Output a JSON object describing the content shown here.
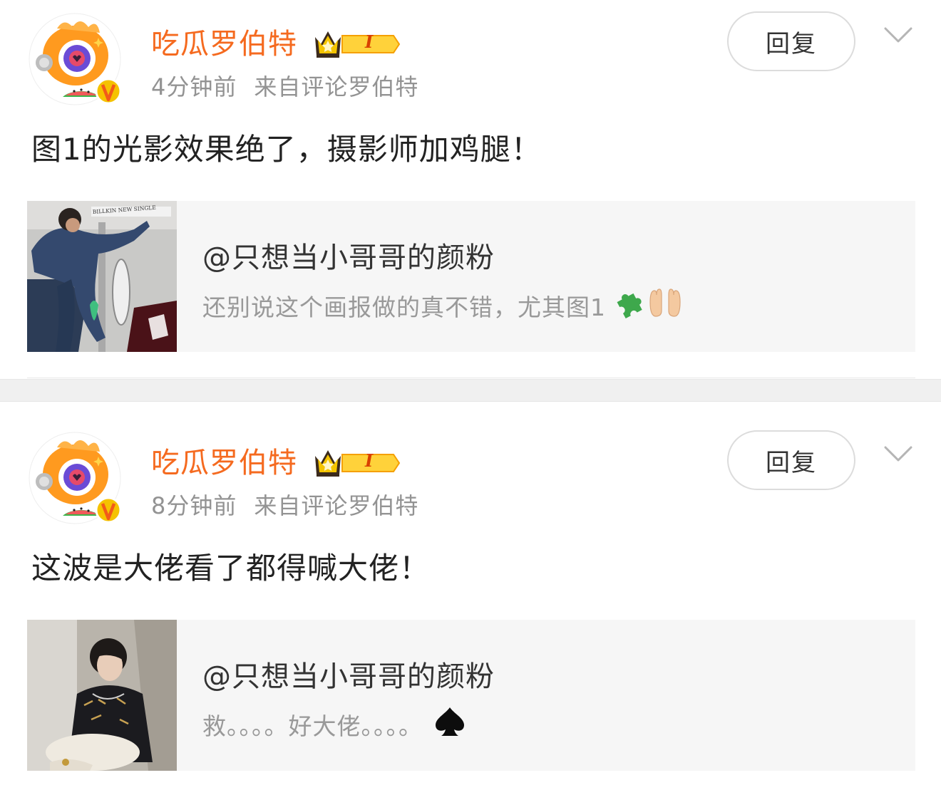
{
  "posts": [
    {
      "username": "吃瓜罗伯特",
      "badge_level": "I",
      "time": "4分钟前",
      "source": "来自评论罗伯特",
      "reply_label": "回复",
      "content": "图1的光影效果绝了，摄影师加鸡腿！",
      "quote": {
        "author": "@只想当小哥哥的颜粉",
        "text": "还别说这个画报做的真不错，尤其图1",
        "thumb_caption": "BILLKIN NEW SINGLE",
        "emojis": [
          "puzzle-piece-icon",
          "palms-up-icon"
        ]
      }
    },
    {
      "username": "吃瓜罗伯特",
      "badge_level": "I",
      "time": "8分钟前",
      "source": "来自评论罗伯特",
      "reply_label": "回复",
      "content": "这波是大佬看了都得喊大佬！",
      "quote": {
        "author": "@只想当小哥哥的颜粉",
        "text": "救。。。。好大佬。。。。",
        "emojis": [
          "spade-icon"
        ]
      }
    }
  ],
  "colors": {
    "username": "#f56a1f",
    "meta": "#939393",
    "quote_bg": "#f6f6f6",
    "separator": "#f0f0f0"
  }
}
